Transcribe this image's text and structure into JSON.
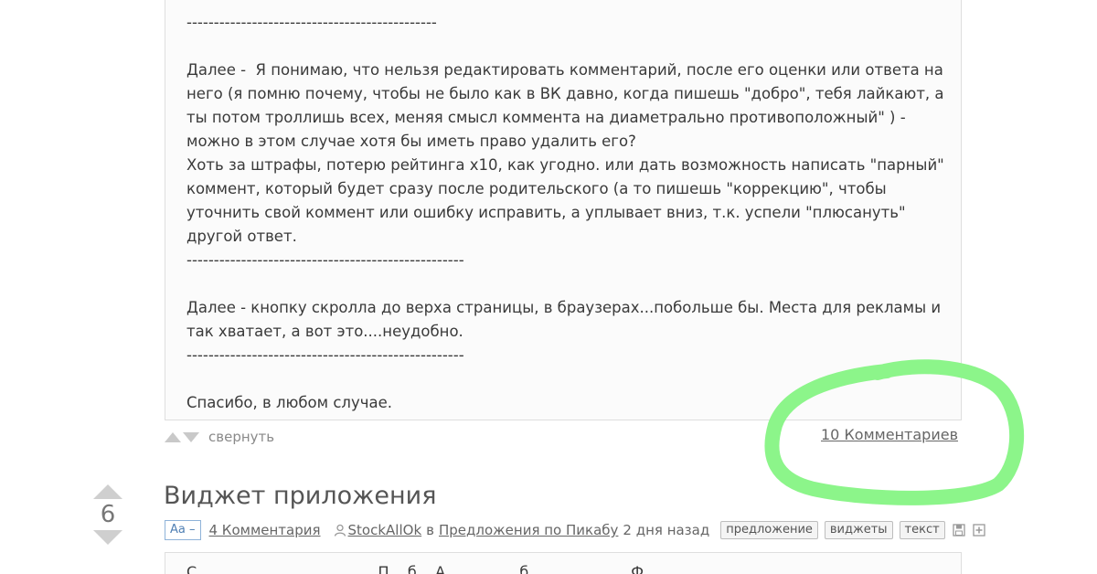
{
  "story": {
    "lines": [
      "",
      "----------------------------------------------",
      "",
      "Далее -  Я понимаю, что нельзя редактировать комментарий, после его оценки или ответа на",
      "него (я помню почему, чтобы не было как в ВК давно, когда пишешь \"добро\", тебя лайкают, а",
      "ты потом троллишь всех, меняя смысл коммента на диаметрально противоположный\" ) -",
      "можно в этом случае хотя бы иметь право удалить его?",
      "Хоть за штрафы, потерю рейтинга х10, как угодно. или дать возможность написать \"парный\"",
      "коммент, который будет сразу после родительского (а то пишешь \"коррекцию\", чтобы",
      "уточнить свой коммент или ошибку исправить, а уплывает вниз, т.к. успели \"плюсануть\"",
      "другой ответ.",
      "---------------------------------------------------",
      "",
      "Далее - кнопку скролла до верха страницы, в браузерах...побольше бы. Места для рекламы и",
      "так хватает, а вот это....неудобно.",
      "---------------------------------------------------",
      "",
      "Спасибо, в любом случае."
    ],
    "collapse_label": "свернуть",
    "comments_link": "10 Комментариев"
  },
  "next_story": {
    "rating": "6",
    "title": "Виджет приложения",
    "font_toggle": "Aa –",
    "comments_link": "4 Комментария",
    "author": "StockAllOk",
    "in_word": "в",
    "community": "Предложения по Пикабу",
    "time": "2 дня назад",
    "tags": [
      "предложение",
      "виджеты",
      "текст"
    ],
    "preview": "С                                       П    б    А                б                      Ф"
  },
  "colors": {
    "highlight": "#8cf58a",
    "link": "#666666",
    "accent": "#4f7fb3"
  },
  "icons": {
    "user": "user-icon",
    "save": "save-icon",
    "add": "add-icon",
    "arrow_up": "arrow-up-icon",
    "arrow_down": "arrow-down-icon"
  }
}
